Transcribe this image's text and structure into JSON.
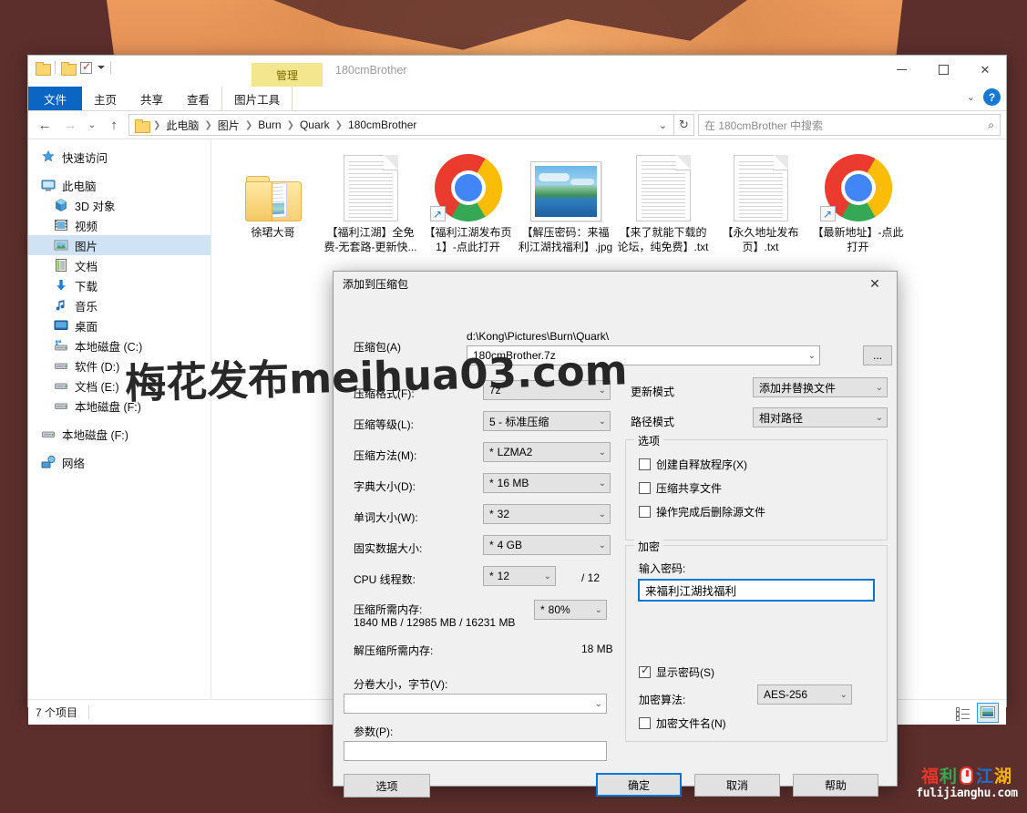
{
  "window": {
    "title": "180cmBrother",
    "quick_access_icons": [
      "folder-icon",
      "folder-icon",
      "checkbox-icon",
      "chevron-down-icon"
    ],
    "controls": {
      "minimize": "minimize-icon",
      "maximize": "maximize-icon",
      "close": "close-icon",
      "help": "?"
    }
  },
  "ribbon": {
    "contextual_group": "图片工具",
    "contextual_title": "管理",
    "tabs": [
      {
        "label": "文件",
        "active": false,
        "style": "file"
      },
      {
        "label": "主页",
        "active": false
      },
      {
        "label": "共享",
        "active": false
      },
      {
        "label": "查看",
        "active": false
      },
      {
        "label": "图片工具",
        "active": true
      }
    ]
  },
  "address": {
    "back": "←",
    "forward": "→",
    "recent": "⌄",
    "up": "↑",
    "crumbs": [
      "此电脑",
      "图片",
      "Burn",
      "Quark",
      "180cmBrother"
    ],
    "dropdown": "⌄",
    "refresh": "↻",
    "search_placeholder": "在 180cmBrother 中搜索",
    "search_value": "",
    "search_icon": "search-icon"
  },
  "sidebar": {
    "items": [
      {
        "label": "快速访问",
        "icon": "star-icon",
        "indent": 0,
        "selected": false,
        "gap": false
      },
      {
        "label": "此电脑",
        "icon": "computer-icon",
        "indent": 0,
        "selected": false,
        "gap": true
      },
      {
        "label": "3D 对象",
        "icon": "3d-objects-icon",
        "indent": 1,
        "selected": false,
        "gap": false
      },
      {
        "label": "视频",
        "icon": "videos-icon",
        "indent": 1,
        "selected": false,
        "gap": false
      },
      {
        "label": "图片",
        "icon": "pictures-icon",
        "indent": 1,
        "selected": true,
        "gap": false
      },
      {
        "label": "文档",
        "icon": "documents-icon",
        "indent": 1,
        "selected": false,
        "gap": false
      },
      {
        "label": "下载",
        "icon": "downloads-icon",
        "indent": 1,
        "selected": false,
        "gap": false
      },
      {
        "label": "音乐",
        "icon": "music-icon",
        "indent": 1,
        "selected": false,
        "gap": false
      },
      {
        "label": "桌面",
        "icon": "desktop-icon",
        "indent": 1,
        "selected": false,
        "gap": false
      },
      {
        "label": "本地磁盘 (C:)",
        "icon": "system-drive-icon",
        "indent": 1,
        "selected": false,
        "gap": false
      },
      {
        "label": "软件 (D:)",
        "icon": "drive-icon",
        "indent": 1,
        "selected": false,
        "gap": false
      },
      {
        "label": "文档 (E:)",
        "icon": "drive-icon",
        "indent": 1,
        "selected": false,
        "gap": false
      },
      {
        "label": "本地磁盘 (F:)",
        "icon": "drive-icon",
        "indent": 1,
        "selected": false,
        "gap": false
      },
      {
        "label": "本地磁盘 (F:)",
        "icon": "drive-icon",
        "indent": 0,
        "selected": false,
        "gap": true
      },
      {
        "label": "网络",
        "icon": "network-icon",
        "indent": 0,
        "selected": false,
        "gap": true
      }
    ]
  },
  "files": [
    {
      "name": "徐珺大哥",
      "icon": "folder-icon",
      "shortcut": false
    },
    {
      "name": "【福利江湖】全免费-无套路-更新快...",
      "icon": "text-document-icon",
      "shortcut": false
    },
    {
      "name": "【福利江湖发布页1】-点此打开",
      "icon": "chrome-shortcut-icon",
      "shortcut": true
    },
    {
      "name": "【解压密码：来福利江湖找福利】.jpg",
      "icon": "image-file-icon",
      "shortcut": false
    },
    {
      "name": "【来了就能下载的论坛，纯免费】.txt",
      "icon": "text-document-icon",
      "shortcut": false
    },
    {
      "name": "【永久地址发布页】.txt",
      "icon": "text-document-icon",
      "shortcut": false
    },
    {
      "name": "【最新地址】-点此打开",
      "icon": "chrome-shortcut-icon",
      "shortcut": true
    }
  ],
  "status": {
    "item_count": "7 个项目",
    "view_details_icon": "details-view-icon",
    "view_large_icons_icon": "large-icons-view-icon"
  },
  "dialog": {
    "title": "添加到压缩包",
    "close_icon": "close-icon",
    "archive_label": "压缩包(A)",
    "archive_path": "d:\\Kong\\Pictures\\Burn\\Quark\\",
    "archive_name": "180cmBrother.7z",
    "browse_button": "...",
    "format_label": "压缩格式(F):",
    "format_value": "7z",
    "level_label": "压缩等级(L):",
    "level_value": "5 - 标准压缩",
    "method_label": "压缩方法(M):",
    "method_value": "LZMA2",
    "dict_label": "字典大小(D):",
    "dict_value": "16 MB",
    "word_label": "单词大小(W):",
    "word_value": "32",
    "solid_label": "固实数据大小:",
    "solid_value": "4 GB",
    "threads_label": "CPU 线程数:",
    "threads_value": "12",
    "threads_total": "/ 12",
    "mem_compress_label": "压缩所需内存:",
    "mem_compress_value": "1840 MB / 12985 MB / 16231 MB",
    "mem_percent": "80%",
    "mem_decompress_label": "解压缩所需内存:",
    "mem_decompress_value": "18 MB",
    "split_label": "分卷大小，字节(V):",
    "split_value": "",
    "params_label": "参数(P):",
    "params_value": "",
    "options_button": "选项",
    "update_mode_label": "更新模式",
    "update_mode_value": "添加并替换文件",
    "path_mode_label": "路径模式",
    "path_mode_value": "相对路径",
    "options_group": "选项",
    "options_items": [
      {
        "label": "创建自释放程序(X)",
        "checked": false
      },
      {
        "label": "压缩共享文件",
        "checked": false
      },
      {
        "label": "操作完成后删除源文件",
        "checked": false
      }
    ],
    "encrypt_group": "加密",
    "password_label": "输入密码:",
    "password_value": "来福利江湖找福利",
    "show_password_label": "显示密码(S)",
    "show_password_checked": true,
    "encrypt_method_label": "加密算法:",
    "encrypt_method_value": "AES-256",
    "encrypt_filenames_label": "加密文件名(N)",
    "encrypt_filenames_checked": false,
    "ok_button": "确定",
    "cancel_button": "取消",
    "help_button": "帮助"
  },
  "watermarks": {
    "center_text": "梅花发布meihua03.com",
    "logo_chars": [
      "福",
      "利",
      "江",
      "湖"
    ],
    "logo_domain": "fulijianghu.com"
  },
  "colors": {
    "accent": "#0078d7",
    "selection": "#cfe3f5",
    "file_tab": "#0b65c2",
    "contextual_tab": "#f2e68e"
  }
}
